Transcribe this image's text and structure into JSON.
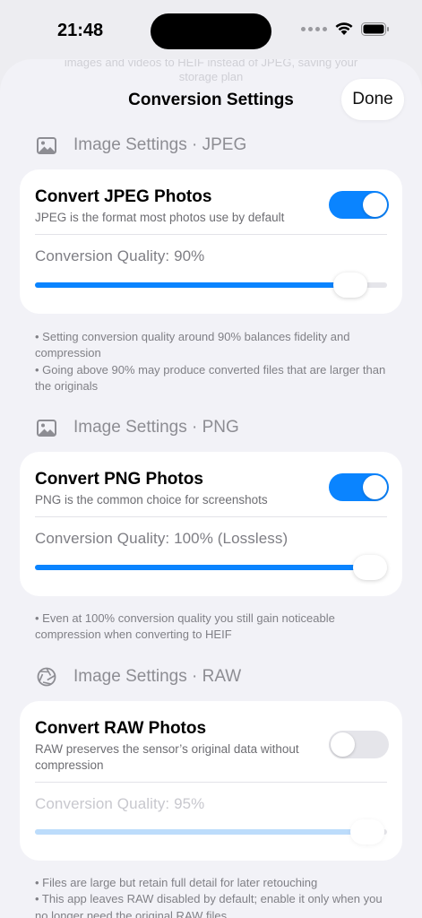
{
  "status": {
    "time": "21:48"
  },
  "sheet": {
    "ghost_line1": "images and videos to HEIF instead of JPEG, saving your",
    "ghost_line2": "storage plan",
    "title": "Conversion Settings",
    "done_label": "Done"
  },
  "sections": {
    "jpeg": {
      "header": "Image Settings · JPEG",
      "icon": "photo-icon",
      "toggle_title": "Convert JPEG Photos",
      "toggle_subtitle": "JPEG is the format most photos use by default",
      "enabled": true,
      "quality_label": "Conversion Quality:  90%",
      "quality_value": 90,
      "notes": [
        "• Setting conversion quality around 90% balances fidelity and compression",
        "• Going above 90% may produce converted files that are larger than the originals"
      ]
    },
    "png": {
      "header": "Image Settings · PNG",
      "icon": "photo-icon",
      "toggle_title": "Convert PNG Photos",
      "toggle_subtitle": "PNG is the common choice for screenshots",
      "enabled": true,
      "quality_label": "Conversion Quality:  100%  (Lossless)",
      "quality_value": 100,
      "notes": [
        "• Even at 100% conversion quality you still gain noticeable compression when converting to HEIF"
      ]
    },
    "raw": {
      "header": "Image Settings · RAW",
      "icon": "aperture-icon",
      "toggle_title": "Convert RAW Photos",
      "toggle_subtitle": "RAW preserves the sensor’s original data without compression",
      "enabled": false,
      "quality_label": "Conversion Quality:  95%",
      "quality_value": 95,
      "notes": [
        "• Files are large but retain full detail for later retouching",
        "• This app leaves RAW disabled by default; enable it only when you no longer need the original RAW files"
      ]
    }
  },
  "colors": {
    "accent": "#0a84ff",
    "background": "#f2f2f7"
  }
}
